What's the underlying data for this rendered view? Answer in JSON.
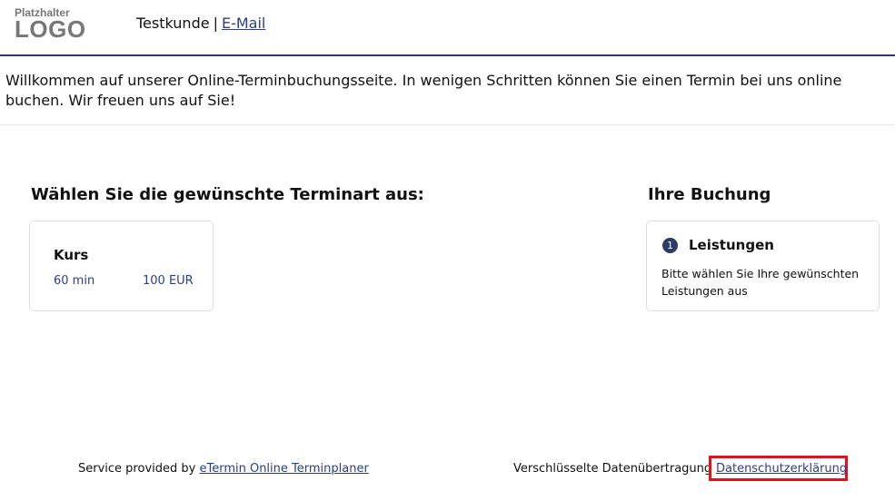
{
  "header": {
    "logo_small": "Platzhalter",
    "logo_big": "LOGO",
    "company_name": "Testkunde",
    "separator": "|",
    "email_link": "E-Mail"
  },
  "welcome_text": "Willkommen auf unserer Online-Terminbuchungsseite. In wenigen Schritten können Sie einen Termin bei uns online buchen. Wir freuen uns auf Sie!",
  "services_section": {
    "title": "Wählen Sie die gewünschte Terminart aus:",
    "items": [
      {
        "name": "Kurs",
        "duration": "60 min",
        "price": "100 EUR"
      }
    ]
  },
  "booking_section": {
    "title": "Ihre Buchung",
    "step_number": "1",
    "step_title": "Leistungen",
    "step_text": "Bitte wählen Sie Ihre gewünschten Leistungen aus"
  },
  "footer": {
    "service_prefix": "Service provided by",
    "provider_link": "eTermin Online Terminplaner",
    "encryption_text": "Verschlüsselte Datenübertragung",
    "privacy_link": "Datenschutzerklärung"
  },
  "colors": {
    "accent": "#2b3d66",
    "link": "#2b3d88",
    "highlight": "#e0141e"
  }
}
